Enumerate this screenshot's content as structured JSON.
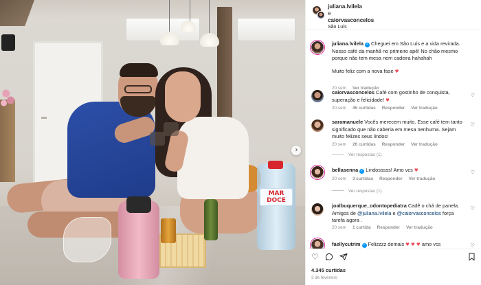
{
  "photo": {
    "water_label": "MAR\nDOCE",
    "next_icon": "chevron-right-icon"
  },
  "header": {
    "user1": "juliana.lvilela",
    "joiner": "e",
    "user2": "caiorvasconcelos",
    "location": "São Luís"
  },
  "caption": {
    "username": "juliana.lvilela",
    "text": "Cheguei em São Luís e a vida revirada. Nosso café da manhã no primeiro apê! No chão mesmo porque não tem mesa nem cadeira hahahah",
    "text2": "Muito feliz com a nova fase",
    "time": "20 sem",
    "translate": "Ver tradução"
  },
  "comments": [
    {
      "username": "caiorvasconcelos",
      "text": "Café com gostinho de conquista, superação e felicidade!",
      "time": "20 sem",
      "likes": "45 curtidas",
      "reply": "Responder",
      "translate": "Ver tradução"
    },
    {
      "username": "saramanuele",
      "text": "Vocês merecem muito. Esse café tem tanto significado que não caberia em mesa nenhuma. Sejam muito felizes seus lindos!",
      "time": "20 sem",
      "likes": "26 curtidas",
      "reply": "Responder",
      "translate": "Ver tradução",
      "replies": "Ver respostas (1)"
    },
    {
      "username": "bellasenna",
      "text": "Lindosssss! Amo vcs",
      "time": "20 sem",
      "likes": "3 curtidas",
      "reply": "Responder",
      "translate": "Ver tradução",
      "replies": "Ver respostas (1)"
    },
    {
      "username": "joalbuquerque_odontopediatra",
      "text_a": "Cadê o chá de panela. Amigos de",
      "mention1": "@juliana.lvilela",
      "text_b": "e",
      "mention2": "@caiorvasconcelos",
      "text_c": "força tarefa agora .",
      "time": "20 sem",
      "likes": "1 curtida",
      "reply": "Responder",
      "translate": "Ver tradução"
    },
    {
      "username": "faellycutrim",
      "text": "Felizzzz demais",
      "text_after": "amo vcs"
    }
  ],
  "actions": {
    "like_icon": "heart-outline-icon",
    "comment_icon": "comment-icon",
    "share_icon": "paper-plane-icon",
    "save_icon": "bookmark-icon",
    "likes": "4.345 curtidas",
    "date": "3 de fevereiro"
  },
  "colors": {
    "verified": "#0095f6",
    "heart": "#ed4956",
    "mention": "#00376b",
    "muted": "#8e8e8e"
  }
}
